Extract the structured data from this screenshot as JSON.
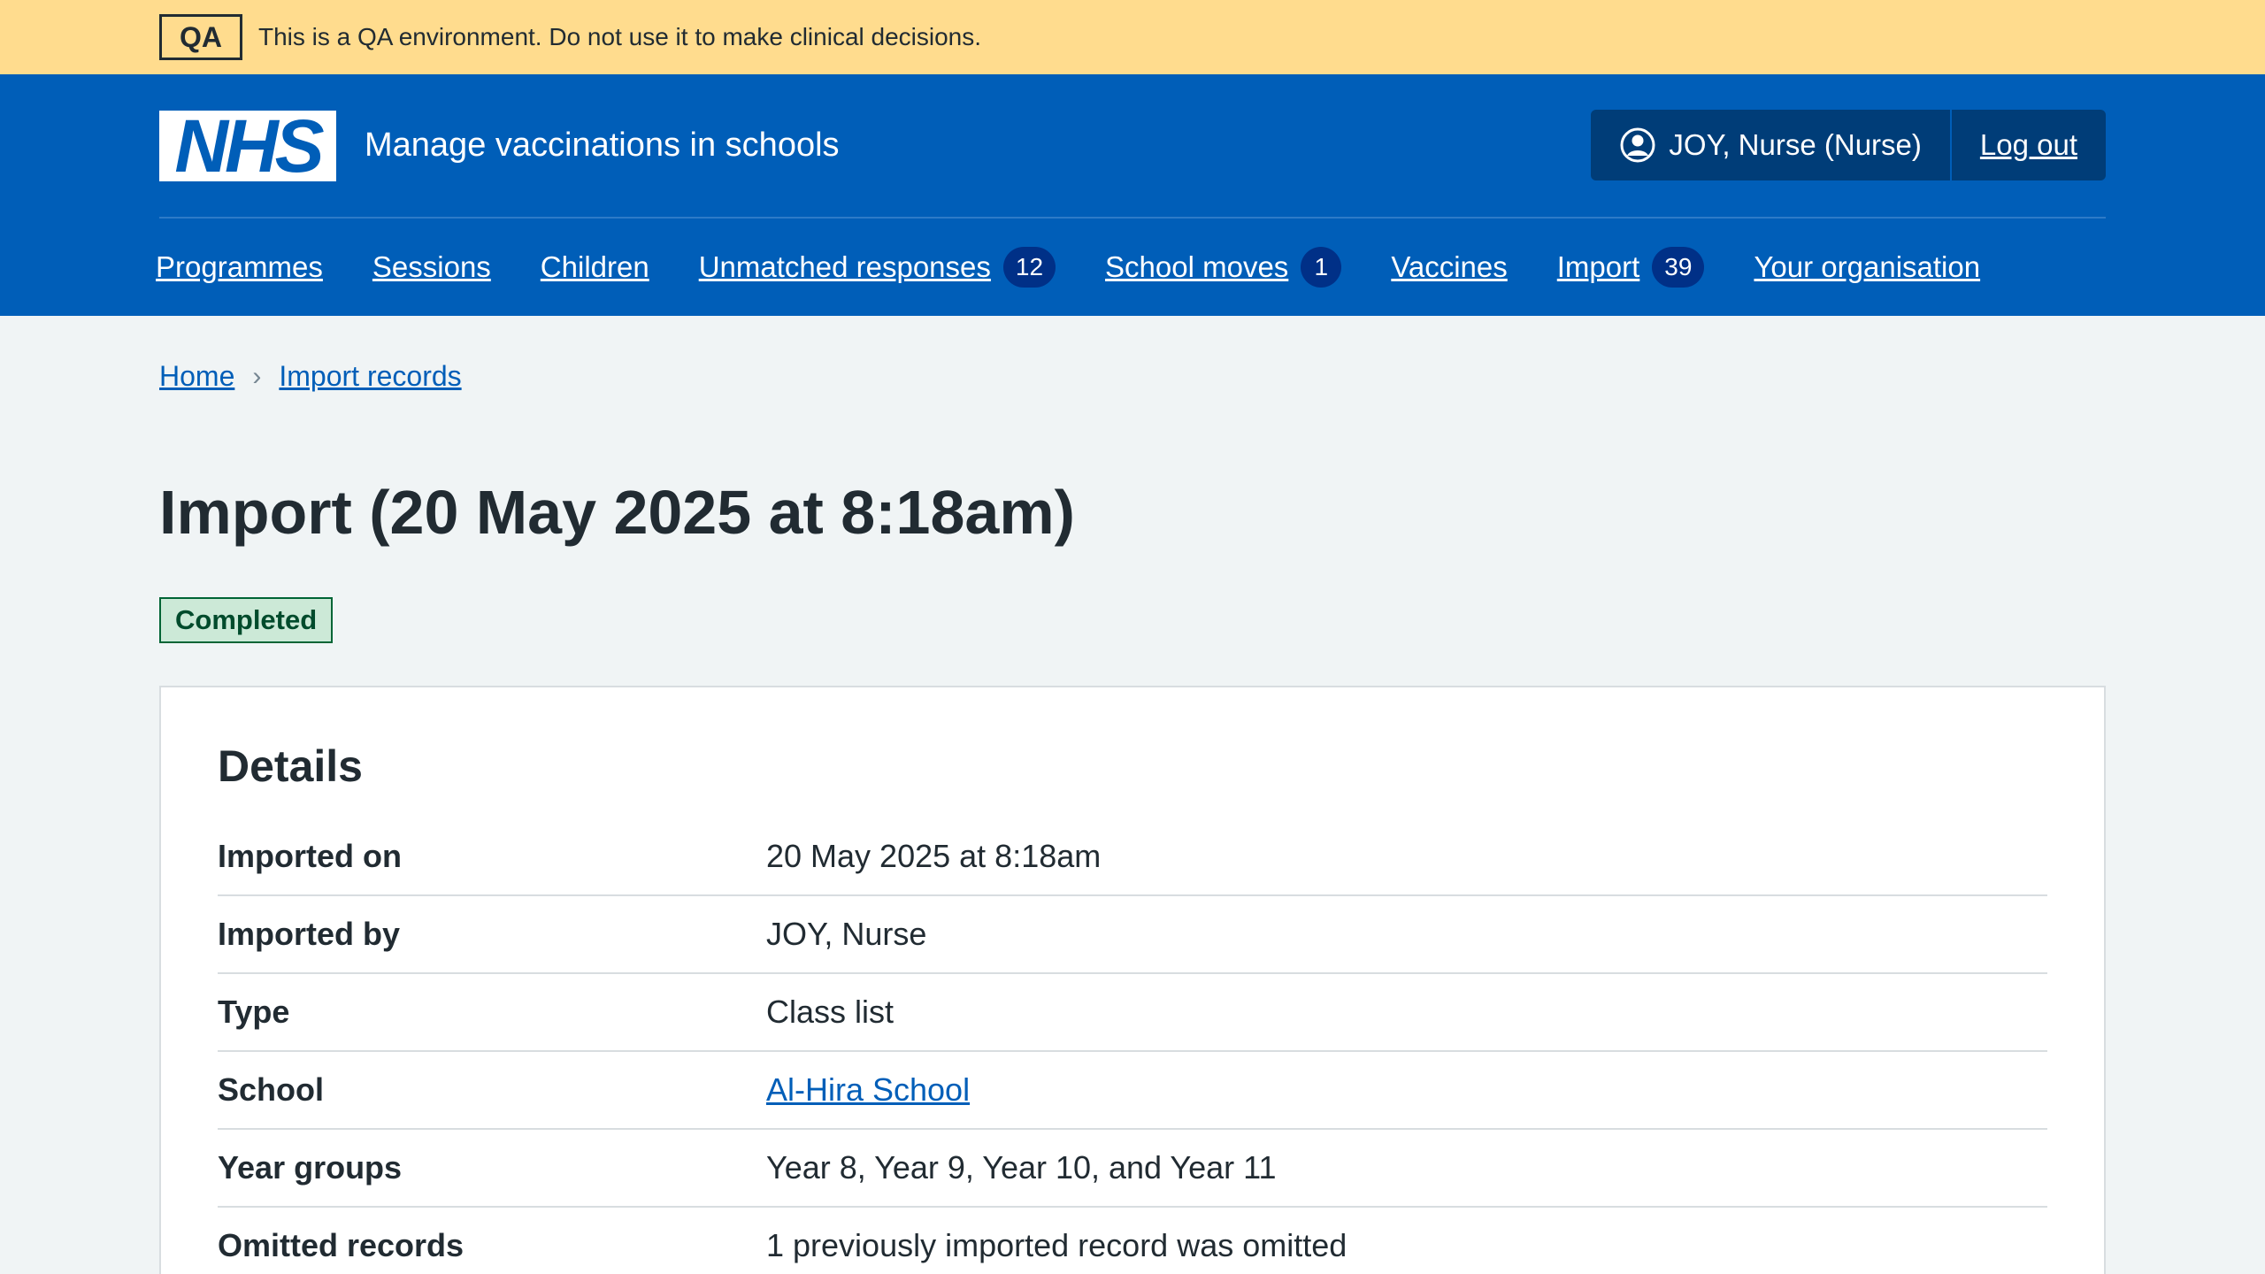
{
  "qa_banner": {
    "tag": "QA",
    "message": "This is a QA environment. Do not use it to make clinical decisions."
  },
  "header": {
    "logo_text": "NHS",
    "service_name": "Manage vaccinations in schools",
    "user_label": "JOY, Nurse (Nurse)",
    "logout_label": "Log out",
    "icon": "user-circle-icon"
  },
  "nav": {
    "items": [
      {
        "label": "Programmes",
        "count": null
      },
      {
        "label": "Sessions",
        "count": null
      },
      {
        "label": "Children",
        "count": null
      },
      {
        "label": "Unmatched responses",
        "count": "12"
      },
      {
        "label": "School moves",
        "count": "1"
      },
      {
        "label": "Vaccines",
        "count": null
      },
      {
        "label": "Import",
        "count": "39"
      },
      {
        "label": "Your organisation",
        "count": null
      }
    ]
  },
  "breadcrumb": {
    "home": "Home",
    "separator": "›",
    "import_records": "Import records"
  },
  "page": {
    "title": "Import (20 May 2025 at 8:18am)",
    "status": "Completed"
  },
  "details": {
    "title": "Details",
    "rows": [
      {
        "key": "Imported on",
        "value": "20 May 2025 at 8:18am"
      },
      {
        "key": "Imported by",
        "value": "JOY, Nurse"
      },
      {
        "key": "Type",
        "value": "Class list"
      },
      {
        "key": "School",
        "value": "Al-Hira School"
      },
      {
        "key": "Year groups",
        "value": "Year 8, Year 9, Year 10, and Year 11"
      },
      {
        "key": "Omitted records",
        "value": "1 previously imported record was omitted"
      }
    ]
  },
  "colors": {
    "nhs_blue": "#005eb8",
    "qa_yellow": "#ffdc8e",
    "status_green": "#cce9d7"
  }
}
